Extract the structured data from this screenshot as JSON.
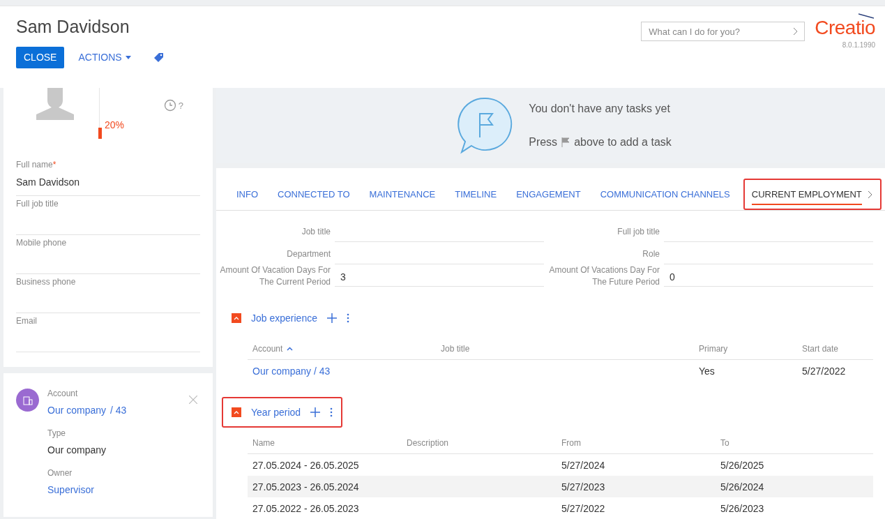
{
  "header": {
    "title": "Sam Davidson",
    "close_button": "CLOSE",
    "actions_button": "ACTIONS",
    "search": {
      "placeholder": "What can I do for you?"
    },
    "logo": "Creatio",
    "version": "8.0.1.1990"
  },
  "profile": {
    "completeness": {
      "level": 0.2,
      "reading": "20%"
    },
    "timezone_mark": "?",
    "fields": [
      {
        "label": "Full name",
        "required_mark": "*",
        "value": "Sam Davidson"
      },
      {
        "label": "Full job title"
      },
      {
        "label": "Mobile phone"
      },
      {
        "label": "Business phone"
      },
      {
        "label": "Email"
      }
    ]
  },
  "account_card": {
    "account_label": "Account",
    "account_name": "Our company",
    "account_suffix": "/ 43",
    "type_label": "Type",
    "type_value": "Our company",
    "owner_label": "Owner",
    "owner_value": "Supervisor"
  },
  "tasks": {
    "line1": "You don't have any tasks yet",
    "line2_before": "Press",
    "line2_after": "above to add a task"
  },
  "tabs": [
    {
      "label": "INFO",
      "selected": false,
      "highlighted": false
    },
    {
      "label": "CONNECTED TO",
      "selected": false,
      "highlighted": false
    },
    {
      "label": "MAINTENANCE",
      "selected": false,
      "highlighted": false
    },
    {
      "label": "TIMELINE",
      "selected": false,
      "highlighted": false
    },
    {
      "label": "ENGAGEMENT",
      "selected": false,
      "highlighted": false
    },
    {
      "label": "COMMUNICATION CHANNELS",
      "selected": false,
      "highlighted": false
    },
    {
      "label": "CURRENT EMPLOYMENT",
      "selected": true,
      "highlighted": true
    }
  ],
  "employment_fields": [
    {
      "label": "Job title"
    },
    {
      "label": "Full job title"
    },
    {
      "label": "Department"
    },
    {
      "label": "Role"
    },
    {
      "label": "Amount Of Vacation Days For The Current Period",
      "value": "3"
    },
    {
      "label": "Amount Of Vacations Day For The Future Period",
      "value": "0"
    }
  ],
  "details": [
    {
      "title": "Job experience",
      "expanded": true,
      "highlighted": false,
      "columns": [
        {
          "label": "Account",
          "sorted": true
        },
        {
          "label": "Job title",
          "sorted": false
        },
        {
          "label": "Primary",
          "sorted": false
        },
        {
          "label": "Start date",
          "sorted": false
        }
      ],
      "rows": [
        {
          "cells": [
            "Our company / 43",
            "",
            "Yes",
            "5/27/2022"
          ],
          "link_first": true,
          "shaded": false
        }
      ]
    },
    {
      "title": "Year period",
      "expanded": true,
      "highlighted": true,
      "columns": [
        {
          "label": "Name",
          "sorted": false
        },
        {
          "label": "Description",
          "sorted": false
        },
        {
          "label": "From",
          "sorted": false
        },
        {
          "label": "To",
          "sorted": false
        }
      ],
      "rows": [
        {
          "cells": [
            "27.05.2024 - 26.05.2025",
            "",
            "5/27/2024",
            "5/26/2025"
          ],
          "link_first": false,
          "shaded": false
        },
        {
          "cells": [
            "27.05.2023 - 26.05.2024",
            "",
            "5/27/2023",
            "5/26/2024"
          ],
          "link_first": false,
          "shaded": true
        },
        {
          "cells": [
            "27.05.2022 - 26.05.2023",
            "",
            "5/27/2022",
            "5/26/2023"
          ],
          "link_first": false,
          "shaded": false
        }
      ]
    }
  ]
}
